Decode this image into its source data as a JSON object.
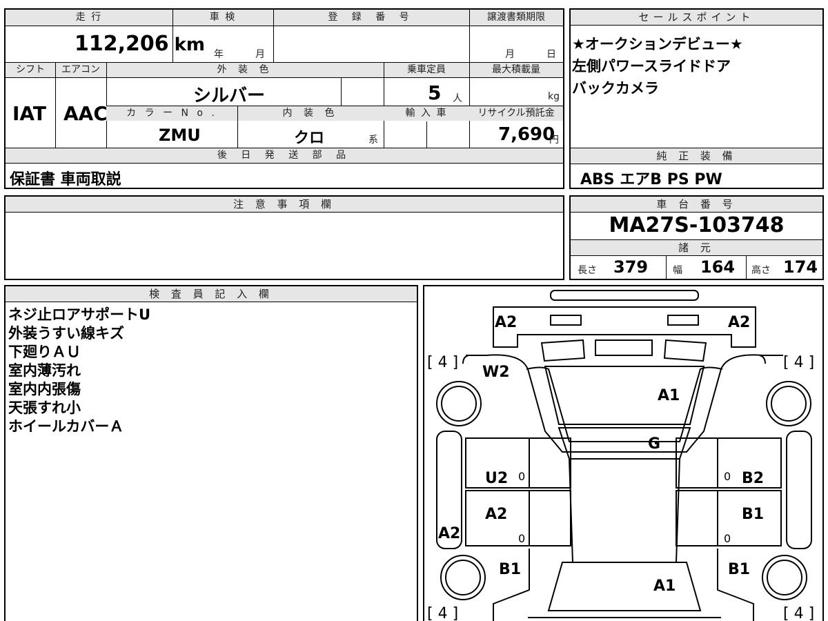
{
  "top_table": {
    "mileage_header": "走 行",
    "mileage_value": "112,206",
    "mileage_unit": "km",
    "inspection_header": "車 検",
    "inspection_year": "年",
    "inspection_month": "月",
    "registration_header": "登 録 番 号",
    "transfer_header": "譲渡書類期限",
    "transfer_month": "月",
    "transfer_day": "日",
    "shift_header": "シフト",
    "shift_value": "IAT",
    "ac_header": "エアコン",
    "ac_value": "AAC",
    "exterior_color_header": "外 装 色",
    "exterior_color_value": "シルバー",
    "capacity_header": "乗車定員",
    "capacity_value": "5",
    "capacity_unit": "人",
    "max_load_header": "最大積載量",
    "max_load_unit": "kg",
    "color_no_header": "カ ラ ー N o .",
    "color_no_value": "ZMU",
    "interior_color_header": "内 装 色",
    "interior_color_value": "クロ",
    "interior_color_suffix": "系",
    "import_header": "輸 入 車",
    "recycle_header": "リサイクル預託金",
    "recycle_value": "7,690",
    "recycle_unit": "円",
    "later_parts_header": "後 日 発 送 部 品",
    "later_parts_value": "保証書 車両取説"
  },
  "sales_points": {
    "header": "セールスポイント",
    "lines": [
      "★オークションデビュー★",
      "左側パワースライドドア",
      "バックカメラ"
    ]
  },
  "standard_equipment": {
    "header": "純 正 装 備",
    "value": "ABS エアB PS PW"
  },
  "notes": {
    "header": "注 意 事 項 欄"
  },
  "chassis": {
    "header": "車 台 番 号",
    "value": "MA27S-103748"
  },
  "specs": {
    "header": "諸 元",
    "length_label": "長さ",
    "length_value": "379",
    "width_label": "幅",
    "width_value": "164",
    "height_label": "高さ",
    "height_value": "174"
  },
  "inspector": {
    "header": "検 査 員 記 入 欄",
    "lines": [
      "ネジ止ロアサポートU",
      "外装うすい線キズ",
      "下廻りＡＵ",
      "室内薄汚れ",
      "室内内張傷",
      "天張すれ小",
      "ホイールカバーＡ"
    ]
  },
  "diagram_marks": {
    "front_left": "A2",
    "front_right": "A2",
    "tire_fl": "[ 4 ]",
    "tire_fr": "[ 4 ]",
    "tire_rl": "[ 4 ]",
    "tire_rr": "[ 4 ]",
    "fender_left": "W2",
    "hood": "A1",
    "windshield": "G",
    "front_door_left": "U2",
    "front_door_right": "B2",
    "rear_door_left": "A2",
    "rear_door_right": "B1",
    "rocker_left": "A2",
    "quarter_left": "B1",
    "quarter_right": "B1",
    "rear": "A1",
    "zero": "0"
  }
}
